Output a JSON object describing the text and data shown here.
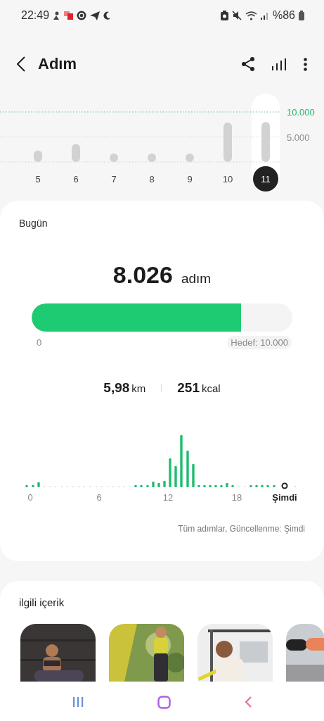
{
  "status_bar": {
    "time": "22:49",
    "battery": "%86"
  },
  "header": {
    "title": "Adım"
  },
  "daily_chart": {
    "chart_data": {
      "type": "bar",
      "categories": [
        "5",
        "6",
        "7",
        "8",
        "9",
        "10",
        "11"
      ],
      "values": [
        2300,
        3600,
        1700,
        1700,
        1700,
        7900,
        8000
      ],
      "ylim": [
        0,
        10000
      ],
      "yticks": [
        {
          "value": 5000,
          "label": "5.000"
        },
        {
          "value": 10000,
          "label": "10.000"
        }
      ]
    },
    "day_states": [
      {
        "selected": false
      },
      {
        "selected": false
      },
      {
        "selected": false
      },
      {
        "selected": false
      },
      {
        "selected": false
      },
      {
        "selected": false
      },
      {
        "selected": true
      }
    ]
  },
  "today": {
    "label": "Bugün",
    "steps": "8.026",
    "steps_unit": "adım",
    "progress": {
      "level": 0.8026,
      "start_label": "0",
      "goal_label": "Hedef: 10.000"
    },
    "distance": "5,98",
    "distance_unit": "km",
    "calories": "251",
    "calories_unit": "kcal",
    "hourly_axis": [
      "0",
      "6",
      "12",
      "18",
      "Şimdi"
    ],
    "caption": "Tüm adımlar, Güncellenme: Şimdi"
  },
  "related": {
    "title": "ilgili içerik"
  }
}
